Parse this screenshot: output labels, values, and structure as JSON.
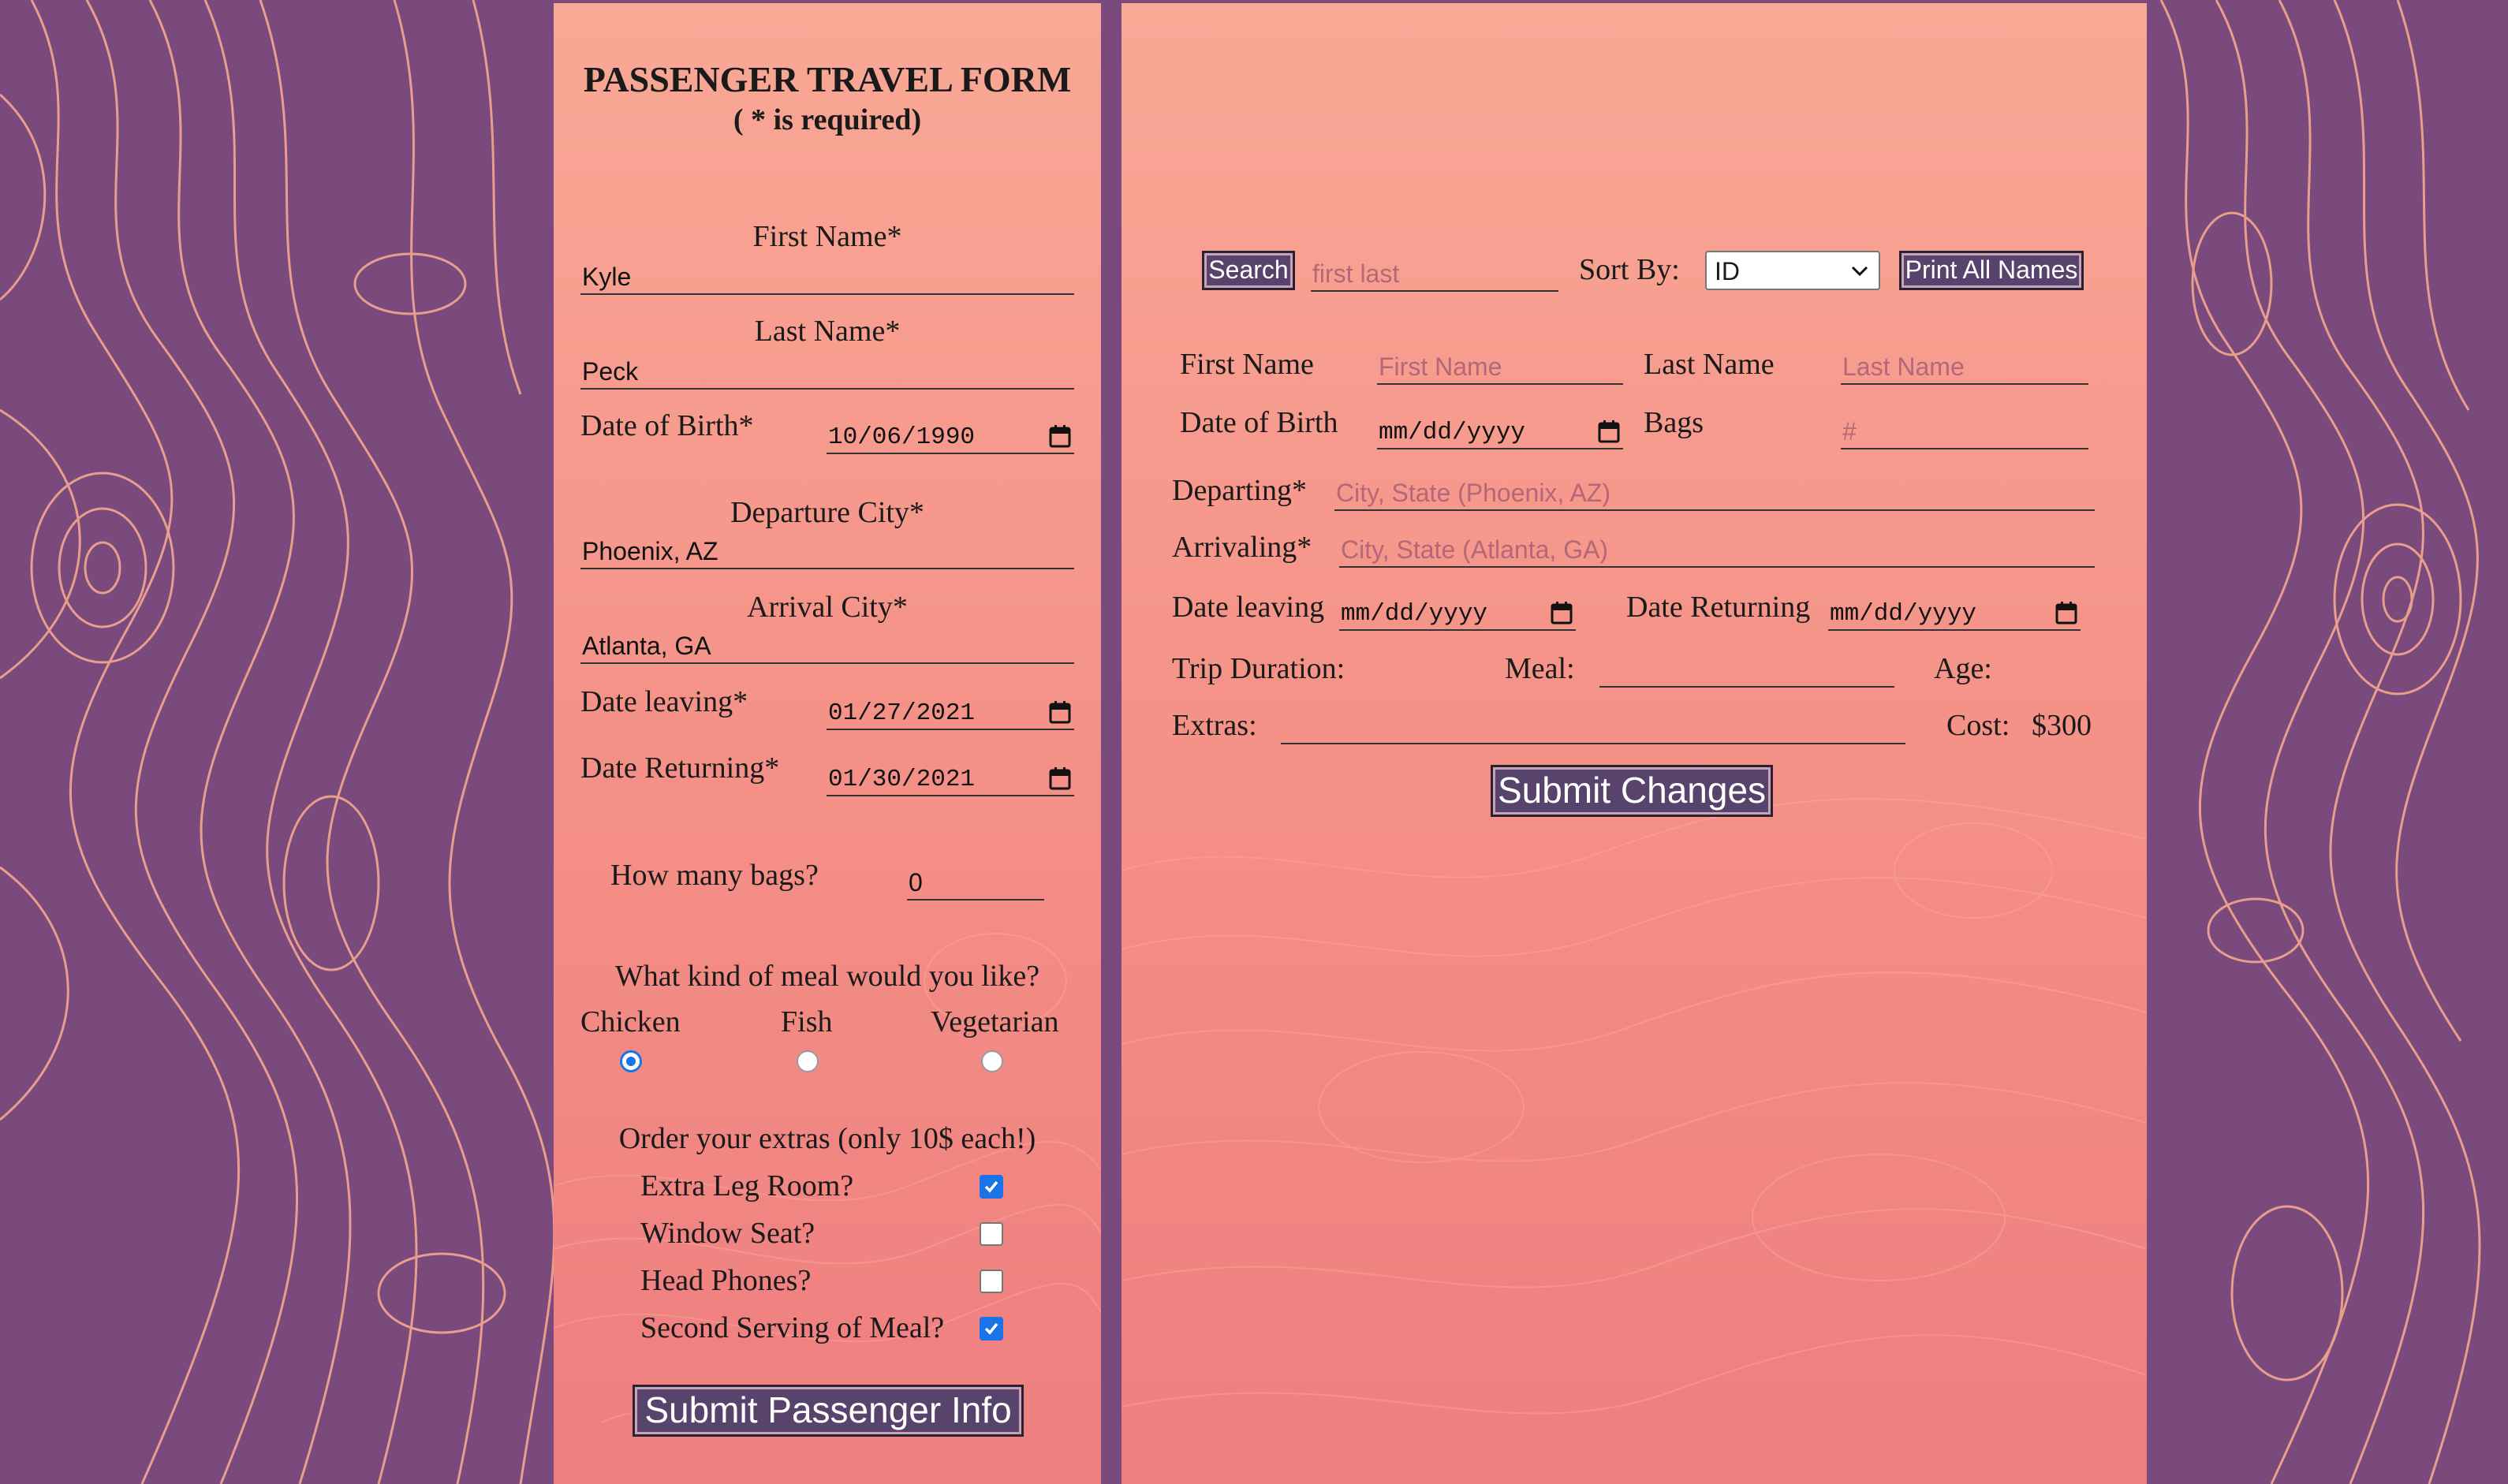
{
  "colors": {
    "background_purple": "#7b4a7c",
    "contour_line": "#f4a88f",
    "panel_top": "#f9a896",
    "panel_bottom": "#ee7e7f",
    "button_bg": "#57436b",
    "checkbox_blue": "#1a73e8"
  },
  "form": {
    "title": "PASSENGER TRAVEL FORM",
    "subtitle": "( * is required)",
    "first_name": {
      "label": "First Name*",
      "value": "Kyle"
    },
    "last_name": {
      "label": "Last Name*",
      "value": "Peck"
    },
    "dob": {
      "label": "Date of Birth*",
      "value": "10/06/1990"
    },
    "departure_city": {
      "label": "Departure City*",
      "value": "Phoenix, AZ"
    },
    "arrival_city": {
      "label": "Arrival City*",
      "value": "Atlanta, GA"
    },
    "date_leaving": {
      "label": "Date leaving*",
      "value": "01/27/2021"
    },
    "date_returning": {
      "label": "Date Returning*",
      "value": "01/30/2021"
    },
    "bags": {
      "label": "How many bags?",
      "value": "0"
    },
    "meal": {
      "question": "What kind of meal would you like?",
      "options": [
        {
          "label": "Chicken",
          "selected": true
        },
        {
          "label": "Fish",
          "selected": false
        },
        {
          "label": "Vegetarian",
          "selected": false
        }
      ]
    },
    "extras": {
      "heading": "Order your extras (only 10$ each!)",
      "items": [
        {
          "label": "Extra Leg Room?",
          "checked": true
        },
        {
          "label": "Window Seat?",
          "checked": false
        },
        {
          "label": "Head Phones?",
          "checked": false
        },
        {
          "label": "Second Serving of Meal?",
          "checked": true
        }
      ]
    },
    "submit_label": "Submit Passenger Info"
  },
  "editor": {
    "search_button": "Search",
    "search_placeholder": "first last",
    "sort_label": "Sort By:",
    "sort_value": "ID",
    "print_button": "Print All Names",
    "first_name_label": "First Name",
    "first_name_placeholder": "First Name",
    "last_name_label": "Last Name",
    "last_name_placeholder": "Last Name",
    "dob_label": "Date of Birth",
    "dob_placeholder": "mm/dd/yyyy",
    "bags_label": "Bags",
    "bags_placeholder": "#",
    "departing_label": "Departing*",
    "departing_placeholder": "City, State (Phoenix, AZ)",
    "arriving_label": "Arrivaling*",
    "arriving_placeholder": "City, State (Atlanta, GA)",
    "date_leaving_label": "Date leaving",
    "date_leaving_placeholder": "mm/dd/yyyy",
    "date_returning_label": "Date Returning",
    "date_returning_placeholder": "mm/dd/yyyy",
    "trip_duration_label": "Trip Duration:",
    "meal_label": "Meal:",
    "age_label": "Age:",
    "extras_label": "Extras:",
    "cost_label": "Cost:",
    "cost_value": "$300",
    "submit_label": "Submit Changes"
  }
}
